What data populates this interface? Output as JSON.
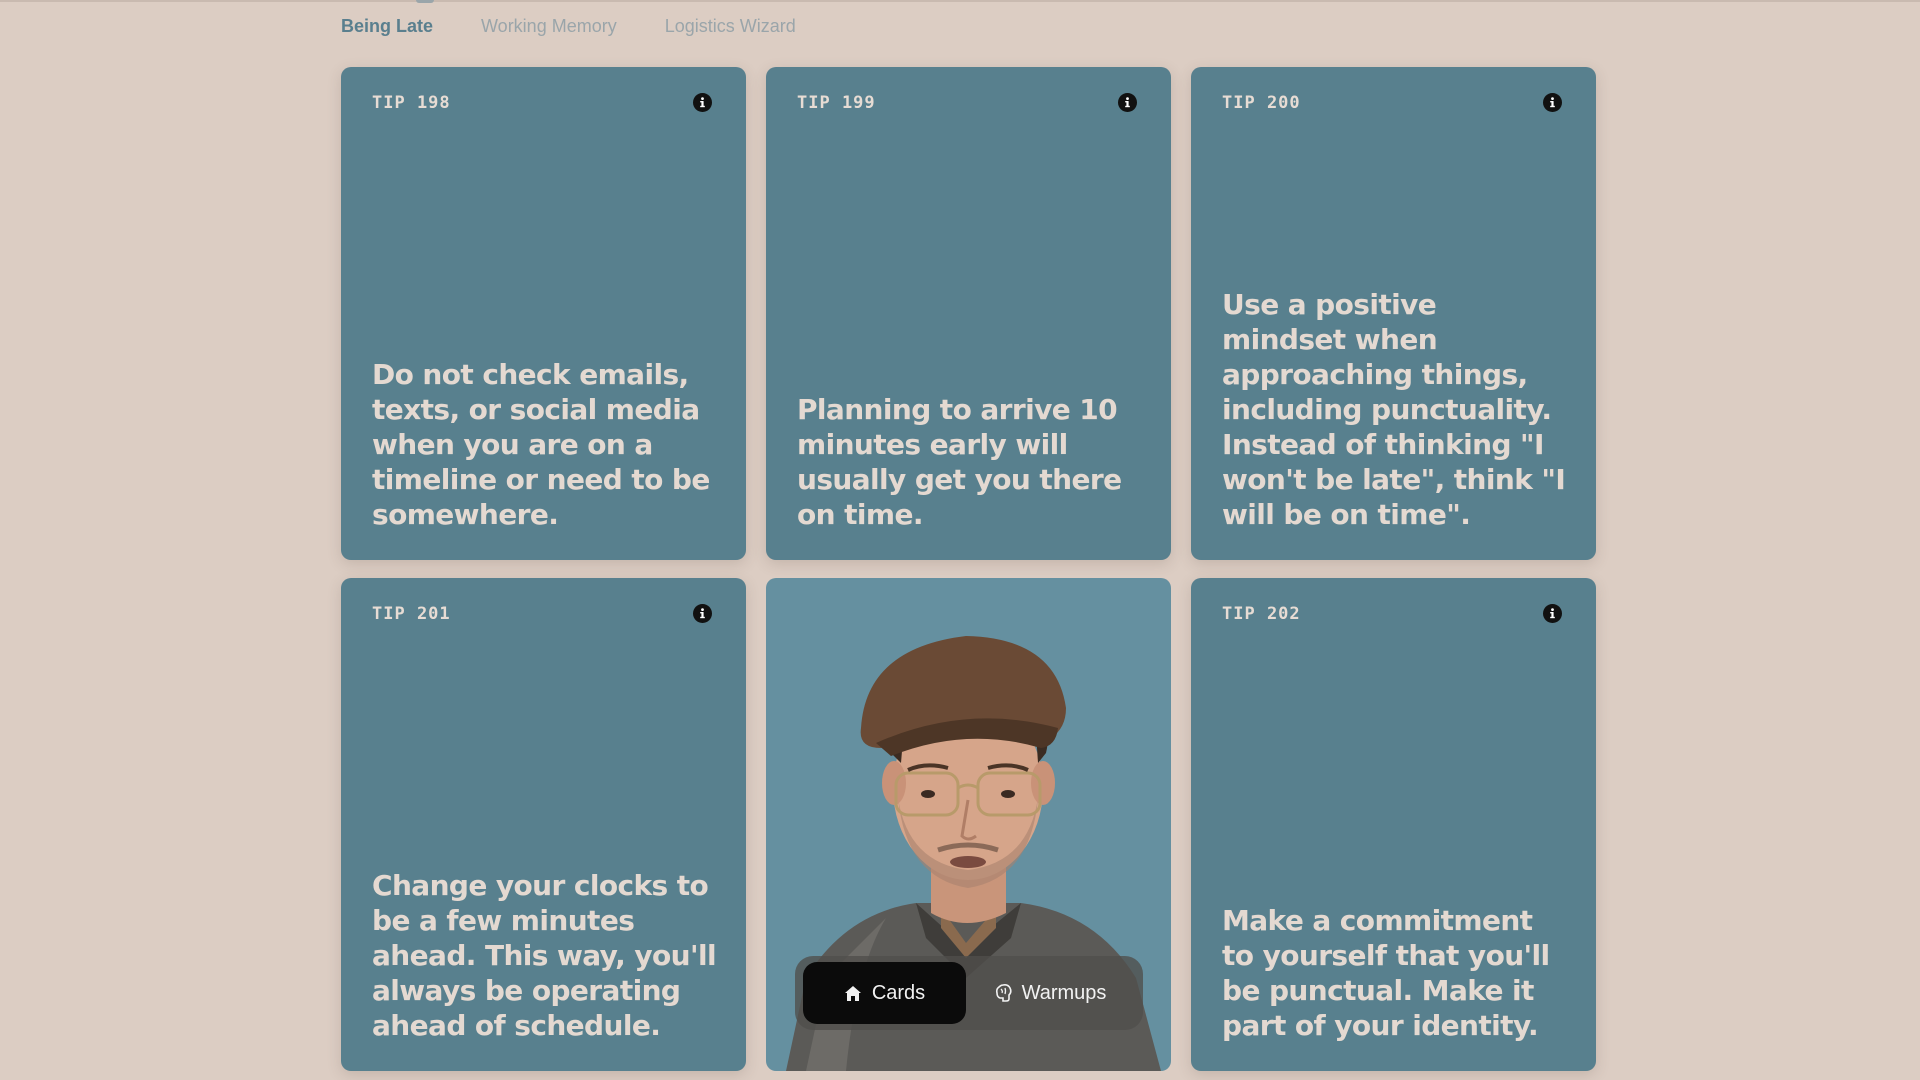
{
  "tabs": [
    {
      "label": "Being Late",
      "active": true
    },
    {
      "label": "Working Memory",
      "active": false
    },
    {
      "label": "Logistics Wizard",
      "active": false
    }
  ],
  "cards": [
    {
      "label": "TIP 198",
      "text": "Do not check emails, texts, or social media when you are on a timeline or need to be somewhere."
    },
    {
      "label": "TIP 199",
      "text": "Planning to arrive 10 minutes early will usually get you there on time."
    },
    {
      "label": "TIP 200",
      "text": "Use a positive mindset when approaching things, including punctuality. Instead of thinking \"I won't be late\", think \"I will be on time\"."
    },
    {
      "label": "TIP 201",
      "text": "Change your clocks to be a few minutes ahead. This way, you'll always be operating ahead of schedule."
    },
    {
      "label": "TIP 202",
      "text": "Make a commitment to yourself that you'll be punctual. Make it part of your identity."
    }
  ],
  "bottom_nav": {
    "cards_label": "Cards",
    "warmups_label": "Warmups",
    "cards_icon": "home-icon",
    "warmups_icon": "brain-icon"
  },
  "colors": {
    "background": "#dccdc3",
    "card": "#58808e",
    "card_text": "#e4d9d1",
    "active_tab": "#5a7f8e",
    "inactive_tab": "#9aa5aa"
  }
}
